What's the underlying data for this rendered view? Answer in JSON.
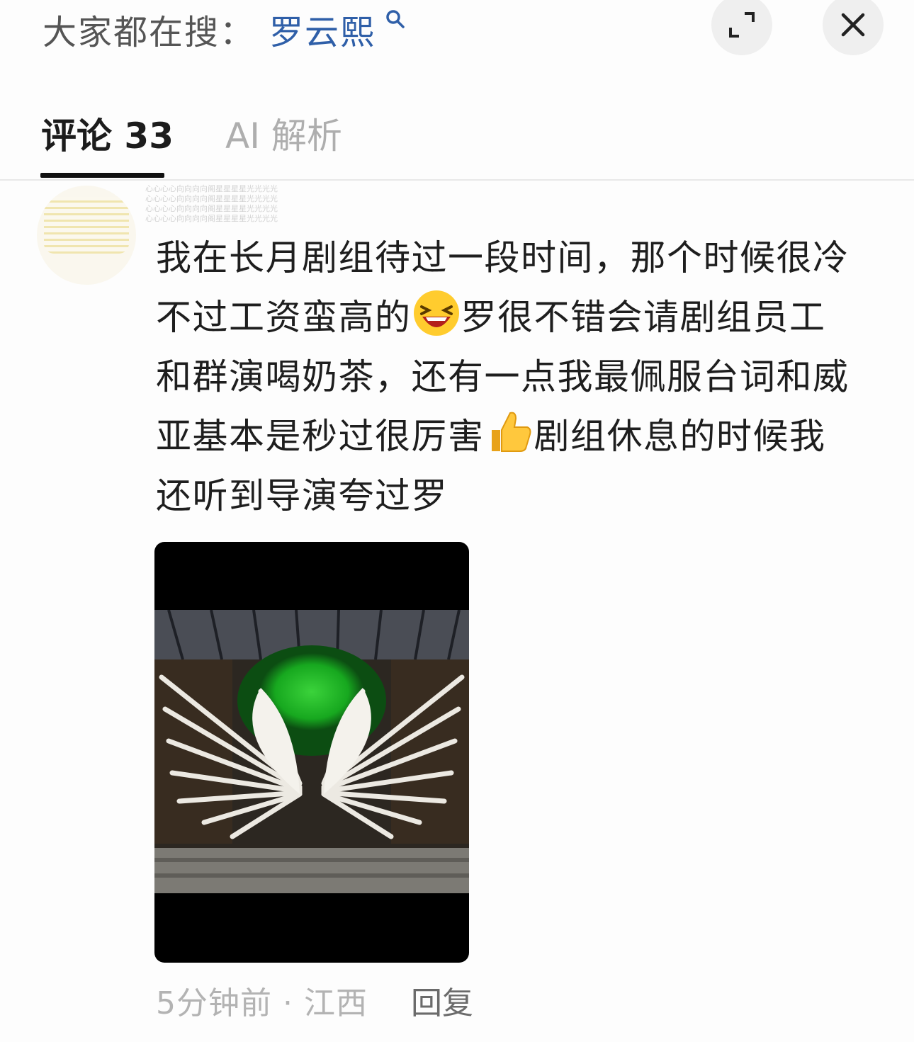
{
  "search": {
    "prefix": "大家都在搜：",
    "term": "罗云熙"
  },
  "header": {
    "expand_icon": "expand-icon",
    "close_icon": "close-icon"
  },
  "tabs": [
    {
      "label": "评论 33",
      "active": true
    },
    {
      "label": "AI 解析",
      "active": false
    }
  ],
  "watermark_lines": [
    "心心心心向向向向阁星星星星光光光光",
    "心心心心向向向向阁星星星星光光光光",
    "心心心心向向向向阁星星星星光光光光",
    "心心心心向向向向阁星星星星光光光光"
  ],
  "comment": {
    "line1": "我在长月剧组待过一段时间，那个时候很冷",
    "line2a": "不过工资蛮高的",
    "emoji1": "laughing-emoji",
    "line2b": "罗很不错会请剧组员工",
    "line3": "和群演喝奶茶，还有一点我最佩服台词和威",
    "line4a": "亚基本是秒过很厉害",
    "emoji2": "thumbs-up-emoji",
    "line4b": "剧组休息的时候我",
    "line5": "还听到导演夸过罗",
    "time": "5分钟前",
    "separator": "·",
    "location": "江西",
    "reply_label": "回复"
  },
  "colors": {
    "accent": "#2f5fa8",
    "tab_inactive": "#aeaeae",
    "meta": "#b3b3b3"
  }
}
